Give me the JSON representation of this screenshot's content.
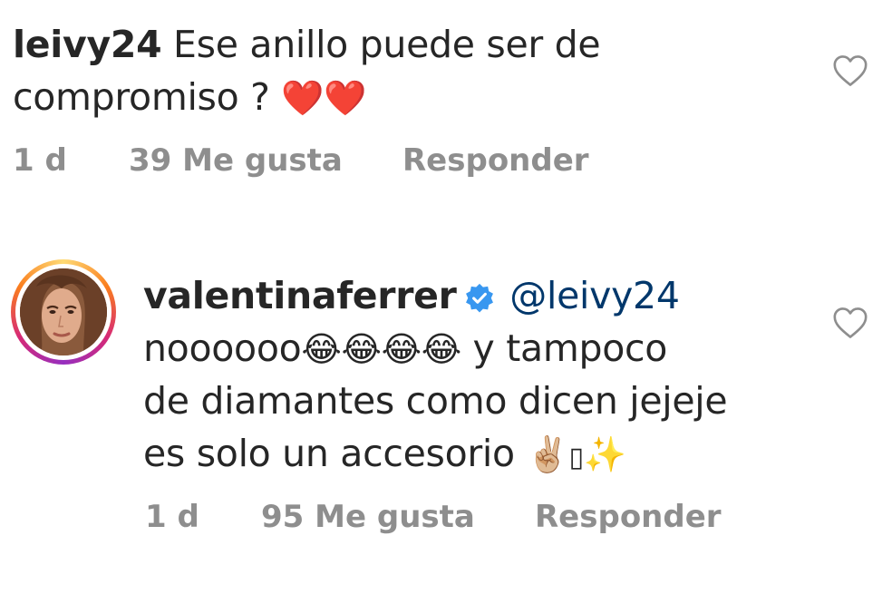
{
  "comments": [
    {
      "username": "leivy24",
      "line1": " Ese anillo puede ser de",
      "line2": "compromiso ? ",
      "emojis": "❤️❤️",
      "time": "1 d",
      "likes": "39 Me gusta",
      "reply": "Responder",
      "like_icon": "heart-outline-icon"
    },
    {
      "username": "valentinaferrer",
      "verified_icon": "verified-badge-icon",
      "mention": "@leivy24",
      "line2_text": "noooooo",
      "line2_emojis": "😂😂😂😂",
      "line2_after": " y tampoco",
      "line3": "de diamantes como dicen  jejeje",
      "line4": "es solo un accesorio ",
      "line4_emojis": "✌🏼",
      "line4_missing": "▯",
      "line4_sparkles": "✨",
      "time": "1 d",
      "likes": "95 Me gusta",
      "reply": "Responder",
      "like_icon": "heart-outline-icon",
      "avatar_icon": "profile-photo-avatar"
    }
  ],
  "colors": {
    "text": "#262626",
    "meta": "#8e8e8e",
    "mention": "#00376b",
    "verified": "#3897f0",
    "heart_emoji": "#e0202f"
  }
}
